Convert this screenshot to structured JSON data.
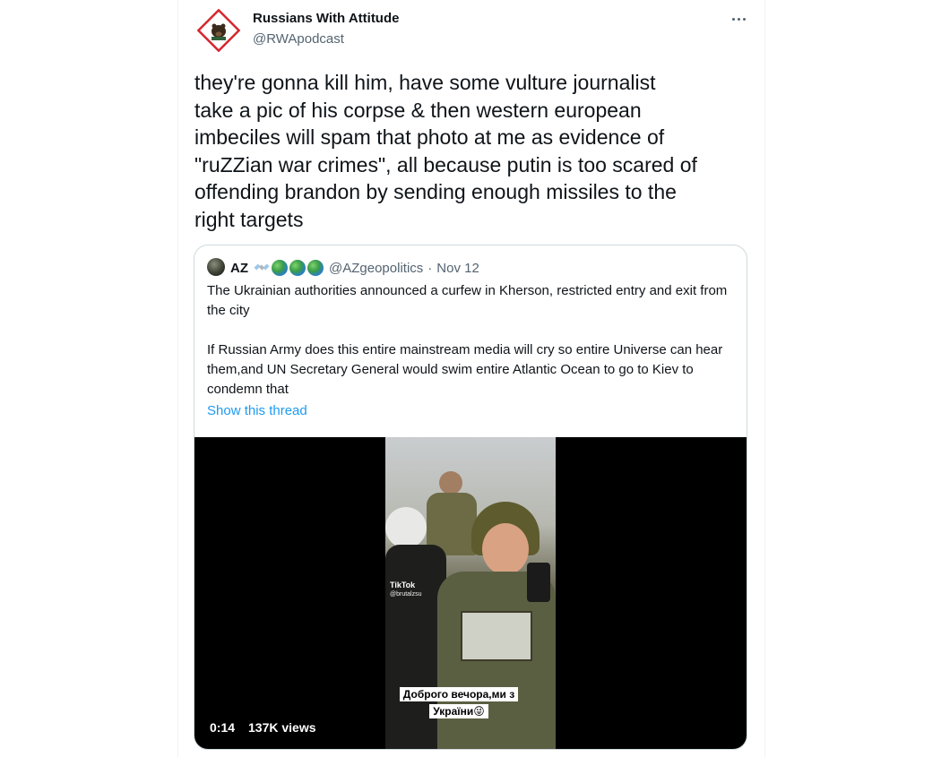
{
  "tweet": {
    "author_name": "Russians With Attitude",
    "author_handle": "@RWApodcast",
    "avatar_icon": "bear-logo-icon",
    "more_icon": "more-options-icon",
    "text": "they're gonna kill him, have some vulture journalist\ntake a pic of his corpse & then western european\nimbeciles will spam that photo at me as evidence of\n\"ruZZian war crimes\", all because putin is too scared of\noffending brandon by sending enough missiles to the\nright targets"
  },
  "quote": {
    "name": "AZ",
    "emoji_icons": [
      "satellite-icon",
      "globe-icon",
      "globe-icon",
      "globe-icon"
    ],
    "handle": "@AZgeopolitics",
    "separator": "·",
    "date": "Nov 12",
    "paragraph1": "The Ukrainian authorities announced a curfew in Kherson, restricted entry and exit from the city",
    "paragraph2": "If Russian Army does this entire mainstream media will cry so entire Universe can hear them,and UN Secretary General would swim entire Atlantic Ocean to go to Kiev to condemn that",
    "show_thread": "Show this thread"
  },
  "video": {
    "watermark": "TikTok",
    "watermark_user": "@brutalzsu",
    "subtitle_line1": "Доброго вечора,ми з",
    "subtitle_line2": "України😜",
    "time": "0:14",
    "views": "137K views"
  },
  "colors": {
    "link": "#1d9bf0",
    "secondary_text": "#536471",
    "border": "#cfd9de",
    "avatar_frame": "#e0245e"
  }
}
